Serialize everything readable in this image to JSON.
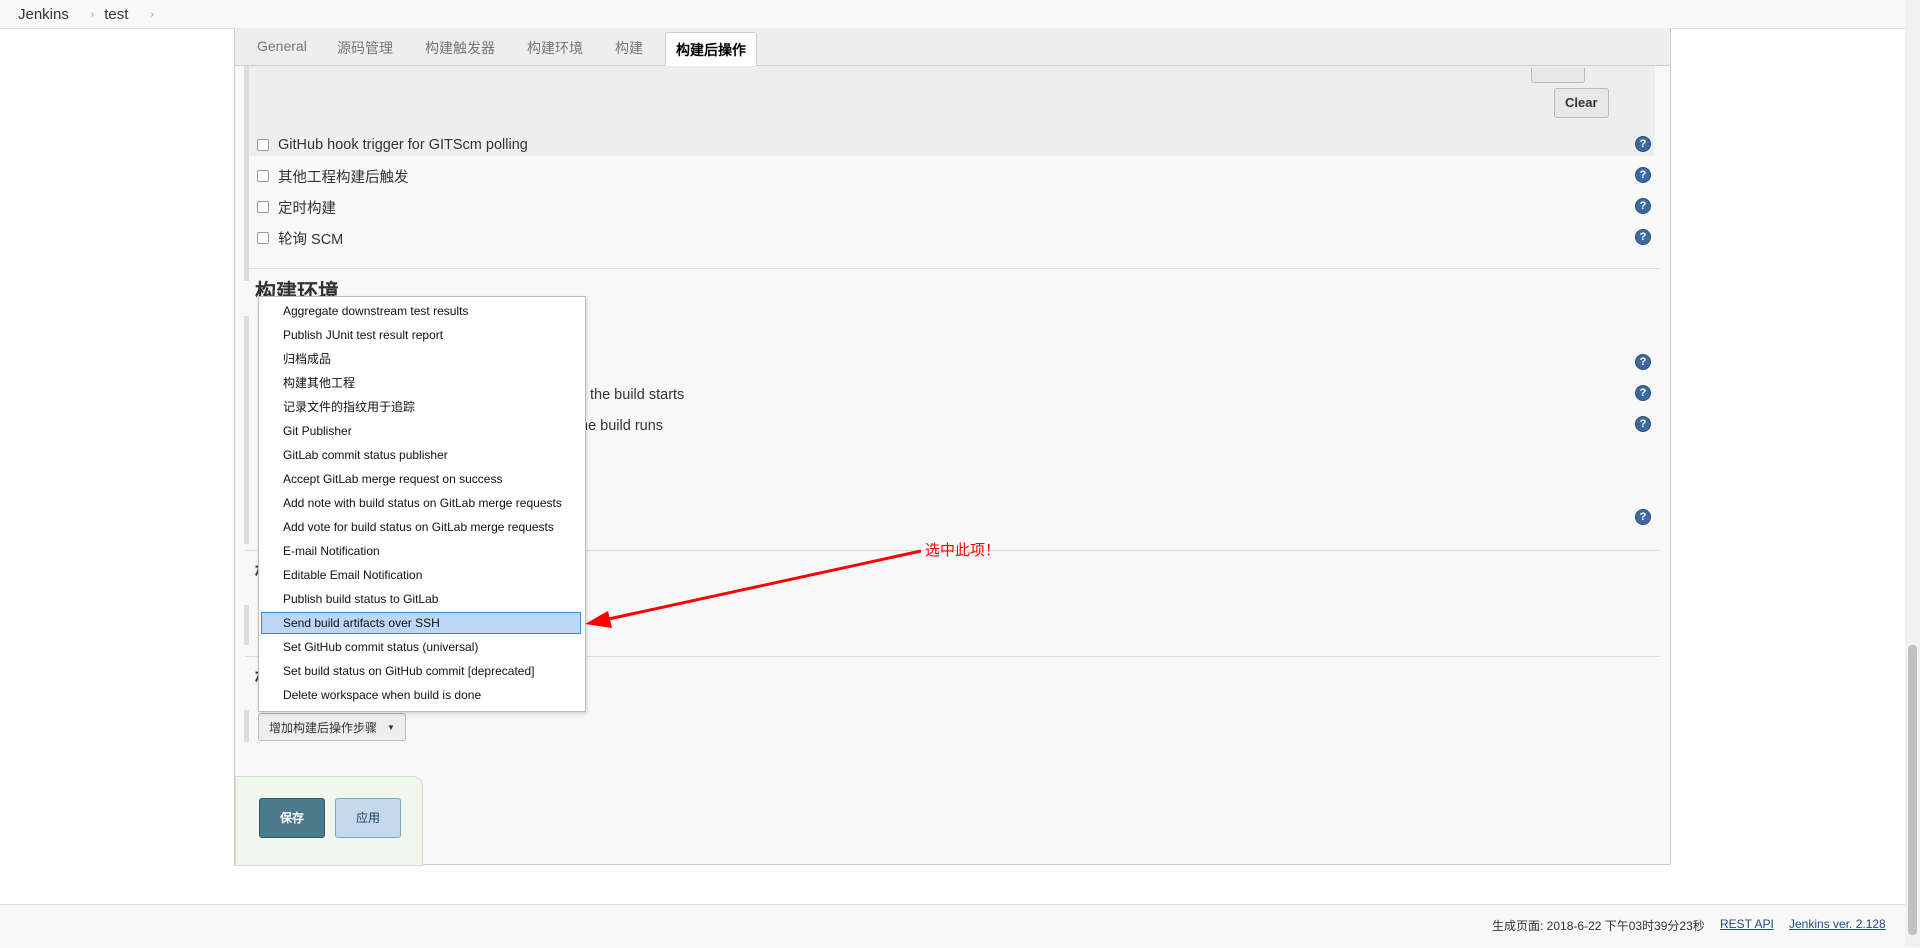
{
  "breadcrumb": {
    "items": [
      "Jenkins",
      "test"
    ],
    "separator": "›"
  },
  "tabs": [
    "General",
    "源码管理",
    "构建触发器",
    "构建环境",
    "构建",
    "构建后操作"
  ],
  "active_tab": "构建后操作",
  "clear_button": "Clear",
  "triggers": [
    "GitHub hook trigger for GITScm polling",
    "其他工程构建后触发",
    "定时构建",
    "轮询 SCM"
  ],
  "build_env": {
    "heading": "构建环境",
    "partial_1": "the build starts",
    "partial_2": "he build runs"
  },
  "partial_heading_glyph": "构",
  "add_step_button": "增加构建后操作步骤",
  "save_button": "保存",
  "apply_button": "应用",
  "help_glyph": "?",
  "dropdown": {
    "items": [
      "Aggregate downstream test results",
      "Publish JUnit test result report",
      "归档成品",
      "构建其他工程",
      "记录文件的指纹用于追踪",
      "Git Publisher",
      "GitLab commit status publisher",
      "Accept GitLab merge request on success",
      "Add note with build status on GitLab merge requests",
      "Add vote for build status on GitLab merge requests",
      "E-mail Notification",
      "Editable Email Notification",
      "Publish build status to GitLab",
      "Send build artifacts over SSH",
      "Set GitHub commit status (universal)",
      "Set build status on GitHub commit [deprecated]",
      "Delete workspace when build is done"
    ],
    "selected": "Send build artifacts over SSH"
  },
  "annotation": "选中此项！",
  "footer": {
    "generated": "生成页面: 2018-6-22 下午03时39分23秒",
    "rest_api": "REST API",
    "version": "Jenkins ver. 2.128"
  },
  "colors": {
    "annotation": "#ff0000",
    "save": "#4a7a8c",
    "apply": "#c4d9ec",
    "selected_bg": "#bcd6f5",
    "help": "#3d6a9e"
  }
}
